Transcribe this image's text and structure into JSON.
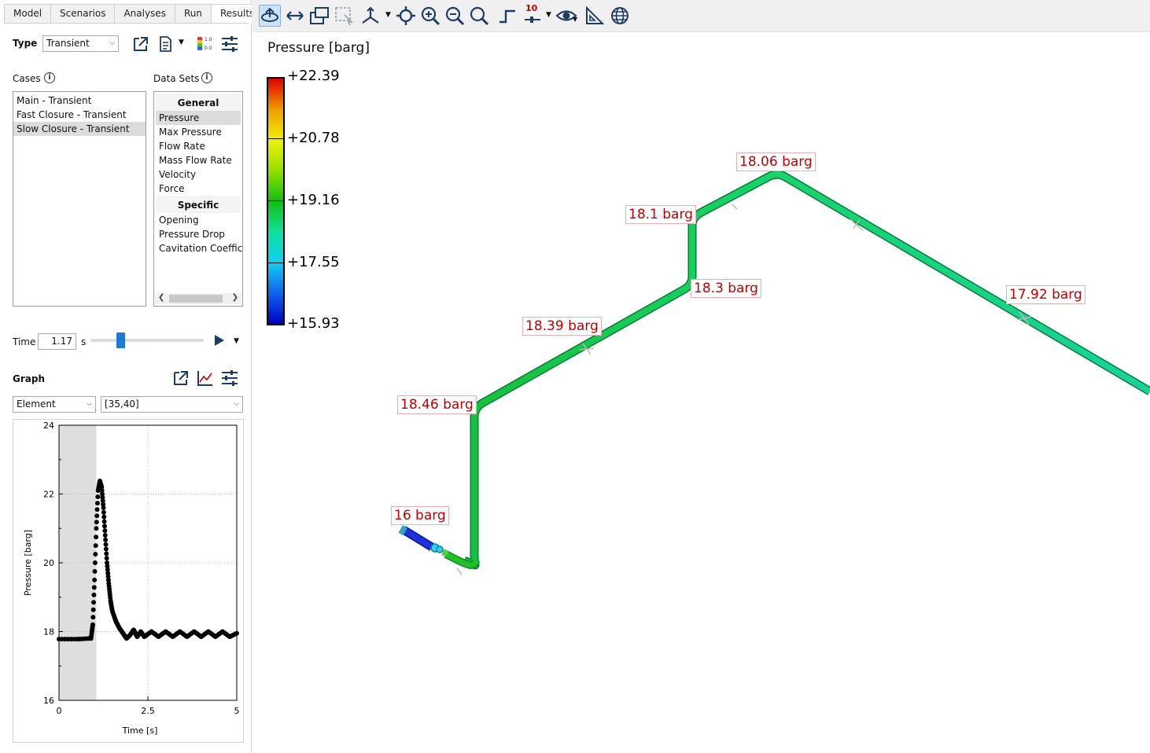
{
  "tabs": [
    "Model",
    "Scenarios",
    "Analyses",
    "Run",
    "Results"
  ],
  "type": {
    "label": "Type",
    "value": "Transient"
  },
  "cases": {
    "label": "Cases",
    "items": [
      "Main - Transient",
      "Fast Closure - Transient",
      "Slow Closure - Transient"
    ],
    "selected": 2
  },
  "datasets": {
    "label": "Data Sets",
    "general_header": "General",
    "general_items": [
      "Pressure",
      "Max Pressure",
      "Flow Rate",
      "Mass Flow Rate",
      "Velocity",
      "Force"
    ],
    "specific_header": "Specific",
    "specific_items": [
      "Opening",
      "Pressure Drop",
      "Cavitation Coefficient"
    ],
    "selected": "Pressure"
  },
  "time": {
    "label": "Time",
    "value": "1.17",
    "unit": "s",
    "slider_fraction": 0.25
  },
  "graph": {
    "label": "Graph",
    "element_select": "Element",
    "range_select": "[35,40]",
    "xlabel": "Time [s]",
    "ylabel": "Pressure [barg]",
    "xticks": [
      "0",
      "2.5",
      "5"
    ],
    "yticks": [
      "16",
      "18",
      "20",
      "22",
      "24"
    ]
  },
  "chart_data": {
    "type": "scatter",
    "xlabel": "Time [s]",
    "ylabel": "Pressure [barg]",
    "xlim": [
      0,
      5
    ],
    "ylim": [
      16,
      24
    ],
    "shaded_until": 1.05,
    "grid": true,
    "series": [
      {
        "x": [
          0,
          0.5,
          0.9,
          0.95,
          1.0,
          1.05,
          1.1,
          1.15,
          1.2,
          1.25,
          1.3,
          1.35,
          1.4,
          1.45,
          1.5,
          1.6,
          1.7,
          1.8,
          1.9,
          2.0,
          2.1,
          2.2,
          2.3,
          2.4,
          2.6,
          2.8,
          3.0,
          3.2,
          3.4,
          3.6,
          3.8,
          4.0,
          4.2,
          4.4,
          4.6,
          4.8,
          5.0
        ],
        "y": [
          17.78,
          17.78,
          17.8,
          18.2,
          19.5,
          21.0,
          22.1,
          22.38,
          22.2,
          21.6,
          20.8,
          20.0,
          19.4,
          18.9,
          18.6,
          18.3,
          18.1,
          17.95,
          17.8,
          17.9,
          18.05,
          17.85,
          18.0,
          17.85,
          18.0,
          17.85,
          18.0,
          17.85,
          18.0,
          17.85,
          18.0,
          17.85,
          18.0,
          17.85,
          18.0,
          17.85,
          17.95
        ]
      }
    ]
  },
  "legend": {
    "title": "Pressure [barg]",
    "ticks": [
      "+22.39",
      "+20.78",
      "+19.16",
      "+17.55",
      "+15.93"
    ],
    "colors": [
      "#e00000",
      "#f0a000",
      "#f0f000",
      "#9ae000",
      "#10c010",
      "#10e0a0",
      "#10d0f0",
      "#1060f0",
      "#0000c0"
    ]
  },
  "pipe_labels": [
    "16 barg",
    "18.46 barg",
    "18.39 barg",
    "18.3 barg",
    "18.1 barg",
    "18.06 barg",
    "17.92 barg"
  ],
  "toolbar_icons": [
    "rotate-icon",
    "pan-icon",
    "fit-icon",
    "select-icon",
    "axes-icon",
    "center-icon",
    "zoom-in-icon",
    "zoom-out-icon",
    "zoom-icon",
    "step-icon",
    "scale-icon",
    "view-icon",
    "measure-icon",
    "globe-icon"
  ],
  "toolbar_scale_text": "10"
}
